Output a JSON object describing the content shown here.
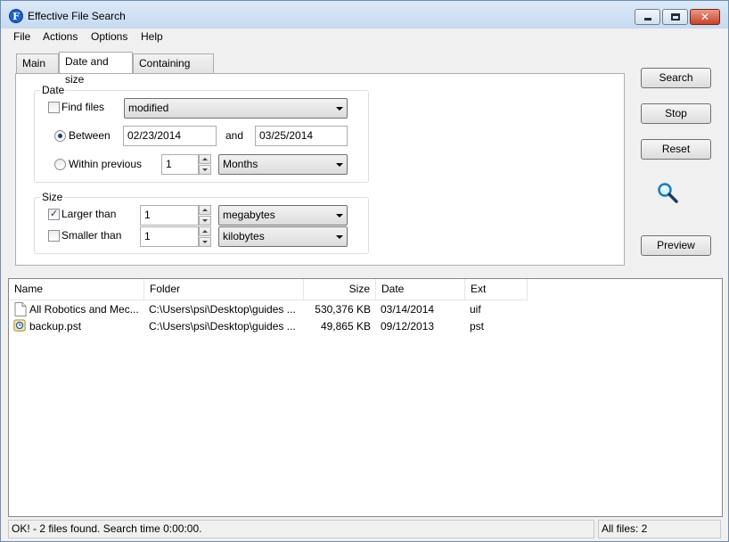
{
  "window": {
    "title": "Effective File Search",
    "app_icon_letter": "F"
  },
  "menu": [
    "File",
    "Actions",
    "Options",
    "Help"
  ],
  "tabs": [
    "Main",
    "Date and size",
    "Containing text"
  ],
  "date_group": {
    "label": "Date",
    "find_files_label": "Find files",
    "find_files_checked": false,
    "date_type": "modified",
    "between_label": "Between",
    "between_selected": true,
    "from_date": "02/23/2014",
    "and_label": "and",
    "to_date": "03/25/2014",
    "within_label": "Within previous",
    "within_selected": false,
    "within_value": "1",
    "within_unit": "Months"
  },
  "size_group": {
    "label": "Size",
    "larger_label": "Larger than",
    "larger_checked": true,
    "larger_value": "1",
    "larger_unit": "megabytes",
    "smaller_label": "Smaller than",
    "smaller_checked": false,
    "smaller_value": "1",
    "smaller_unit": "kilobytes"
  },
  "buttons": {
    "search": "Search",
    "stop": "Stop",
    "reset": "Reset",
    "preview": "Preview"
  },
  "results": {
    "columns": [
      "Name",
      "Folder",
      "Size",
      "Date",
      "Ext"
    ],
    "rows": [
      {
        "name": "All Robotics and Mec...",
        "folder": "C:\\Users\\psi\\Desktop\\guides ...",
        "size": "530,376 KB",
        "date": "03/14/2014",
        "ext": "uif",
        "icon": "document-icon"
      },
      {
        "name": "backup.pst",
        "folder": "C:\\Users\\psi\\Desktop\\guides ...",
        "size": "49,865 KB",
        "date": "09/12/2013",
        "ext": "pst",
        "icon": "outlook-data-file-icon"
      }
    ]
  },
  "status": {
    "message": "OK! - 2 files found. Search time 0:00:00.",
    "total": "All files: 2"
  }
}
